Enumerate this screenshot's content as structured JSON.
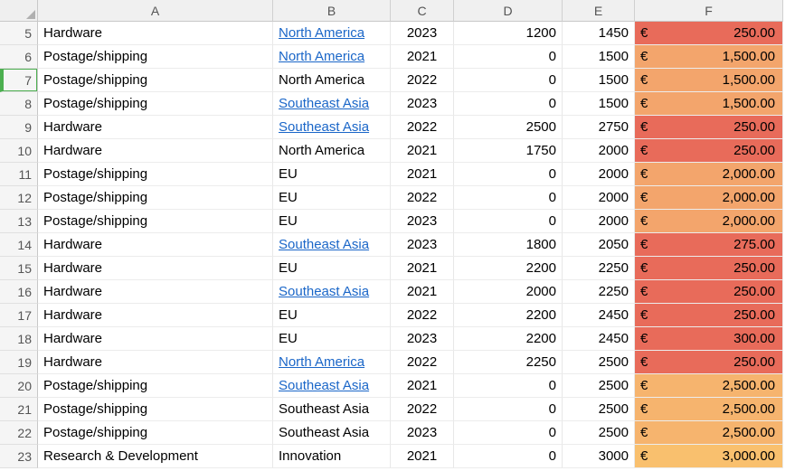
{
  "chart_data": {
    "type": "table",
    "columns": [
      "A",
      "B",
      "C",
      "D",
      "E",
      "F"
    ],
    "rows": [
      {
        "n": 5,
        "A": "Hardware",
        "B": "North America",
        "Blink": true,
        "C": 2023,
        "D": 1200,
        "E": 1450,
        "F": "250.00",
        "Fcolor": "#e86b5a"
      },
      {
        "n": 6,
        "A": "Postage/shipping",
        "B": "North America",
        "Blink": true,
        "C": 2021,
        "D": 0,
        "E": 1500,
        "F": "1,500.00",
        "Fcolor": "#f3a56c"
      },
      {
        "n": 7,
        "A": "Postage/shipping",
        "B": "North America",
        "Blink": false,
        "C": 2022,
        "D": 0,
        "E": 1500,
        "F": "1,500.00",
        "Fcolor": "#f3a56c",
        "sel": true
      },
      {
        "n": 8,
        "A": "Postage/shipping",
        "B": "Southeast Asia",
        "Blink": true,
        "C": 2023,
        "D": 0,
        "E": 1500,
        "F": "1,500.00",
        "Fcolor": "#f3a56c"
      },
      {
        "n": 9,
        "A": "Hardware",
        "B": "Southeast Asia",
        "Blink": true,
        "C": 2022,
        "D": 2500,
        "E": 2750,
        "F": "250.00",
        "Fcolor": "#e86b5a"
      },
      {
        "n": 10,
        "A": "Hardware",
        "B": "North America",
        "Blink": false,
        "C": 2021,
        "D": 1750,
        "E": 2000,
        "F": "250.00",
        "Fcolor": "#e86b5a"
      },
      {
        "n": 11,
        "A": "Postage/shipping",
        "B": "EU",
        "Blink": false,
        "C": 2021,
        "D": 0,
        "E": 2000,
        "F": "2,000.00",
        "Fcolor": "#f3a56c"
      },
      {
        "n": 12,
        "A": "Postage/shipping",
        "B": "EU",
        "Blink": false,
        "C": 2022,
        "D": 0,
        "E": 2000,
        "F": "2,000.00",
        "Fcolor": "#f3a56c"
      },
      {
        "n": 13,
        "A": "Postage/shipping",
        "B": "EU",
        "Blink": false,
        "C": 2023,
        "D": 0,
        "E": 2000,
        "F": "2,000.00",
        "Fcolor": "#f3a56c"
      },
      {
        "n": 14,
        "A": "Hardware",
        "B": "Southeast Asia",
        "Blink": true,
        "C": 2023,
        "D": 1800,
        "E": 2050,
        "F": "275.00",
        "Fcolor": "#e86b5a"
      },
      {
        "n": 15,
        "A": "Hardware",
        "B": "EU",
        "Blink": false,
        "C": 2021,
        "D": 2200,
        "E": 2250,
        "F": "250.00",
        "Fcolor": "#e86b5a"
      },
      {
        "n": 16,
        "A": "Hardware",
        "B": "Southeast Asia",
        "Blink": true,
        "C": 2021,
        "D": 2000,
        "E": 2250,
        "F": "250.00",
        "Fcolor": "#e86b5a"
      },
      {
        "n": 17,
        "A": "Hardware",
        "B": "EU",
        "Blink": false,
        "C": 2022,
        "D": 2200,
        "E": 2450,
        "F": "250.00",
        "Fcolor": "#e86b5a"
      },
      {
        "n": 18,
        "A": "Hardware",
        "B": "EU",
        "Blink": false,
        "C": 2023,
        "D": 2200,
        "E": 2450,
        "F": "300.00",
        "Fcolor": "#e86b5a"
      },
      {
        "n": 19,
        "A": "Hardware",
        "B": "North America",
        "Blink": true,
        "C": 2022,
        "D": 2250,
        "E": 2500,
        "F": "250.00",
        "Fcolor": "#e86b5a"
      },
      {
        "n": 20,
        "A": "Postage/shipping",
        "B": "Southeast Asia",
        "Blink": true,
        "C": 2021,
        "D": 0,
        "E": 2500,
        "F": "2,500.00",
        "Fcolor": "#f6b46e"
      },
      {
        "n": 21,
        "A": "Postage/shipping",
        "B": "Southeast Asia",
        "Blink": false,
        "C": 2022,
        "D": 0,
        "E": 2500,
        "F": "2,500.00",
        "Fcolor": "#f6b46e"
      },
      {
        "n": 22,
        "A": "Postage/shipping",
        "B": "Southeast Asia",
        "Blink": false,
        "C": 2023,
        "D": 0,
        "E": 2500,
        "F": "2,500.00",
        "Fcolor": "#f6b46e"
      },
      {
        "n": 23,
        "A": "Research & Development",
        "B": "Innovation",
        "Blink": false,
        "C": 2021,
        "D": 0,
        "E": 3000,
        "F": "3,000.00",
        "Fcolor": "#f9c06e"
      }
    ]
  },
  "headers": {
    "A": "A",
    "B": "B",
    "C": "C",
    "D": "D",
    "E": "E",
    "F": "F"
  },
  "currency": "€"
}
